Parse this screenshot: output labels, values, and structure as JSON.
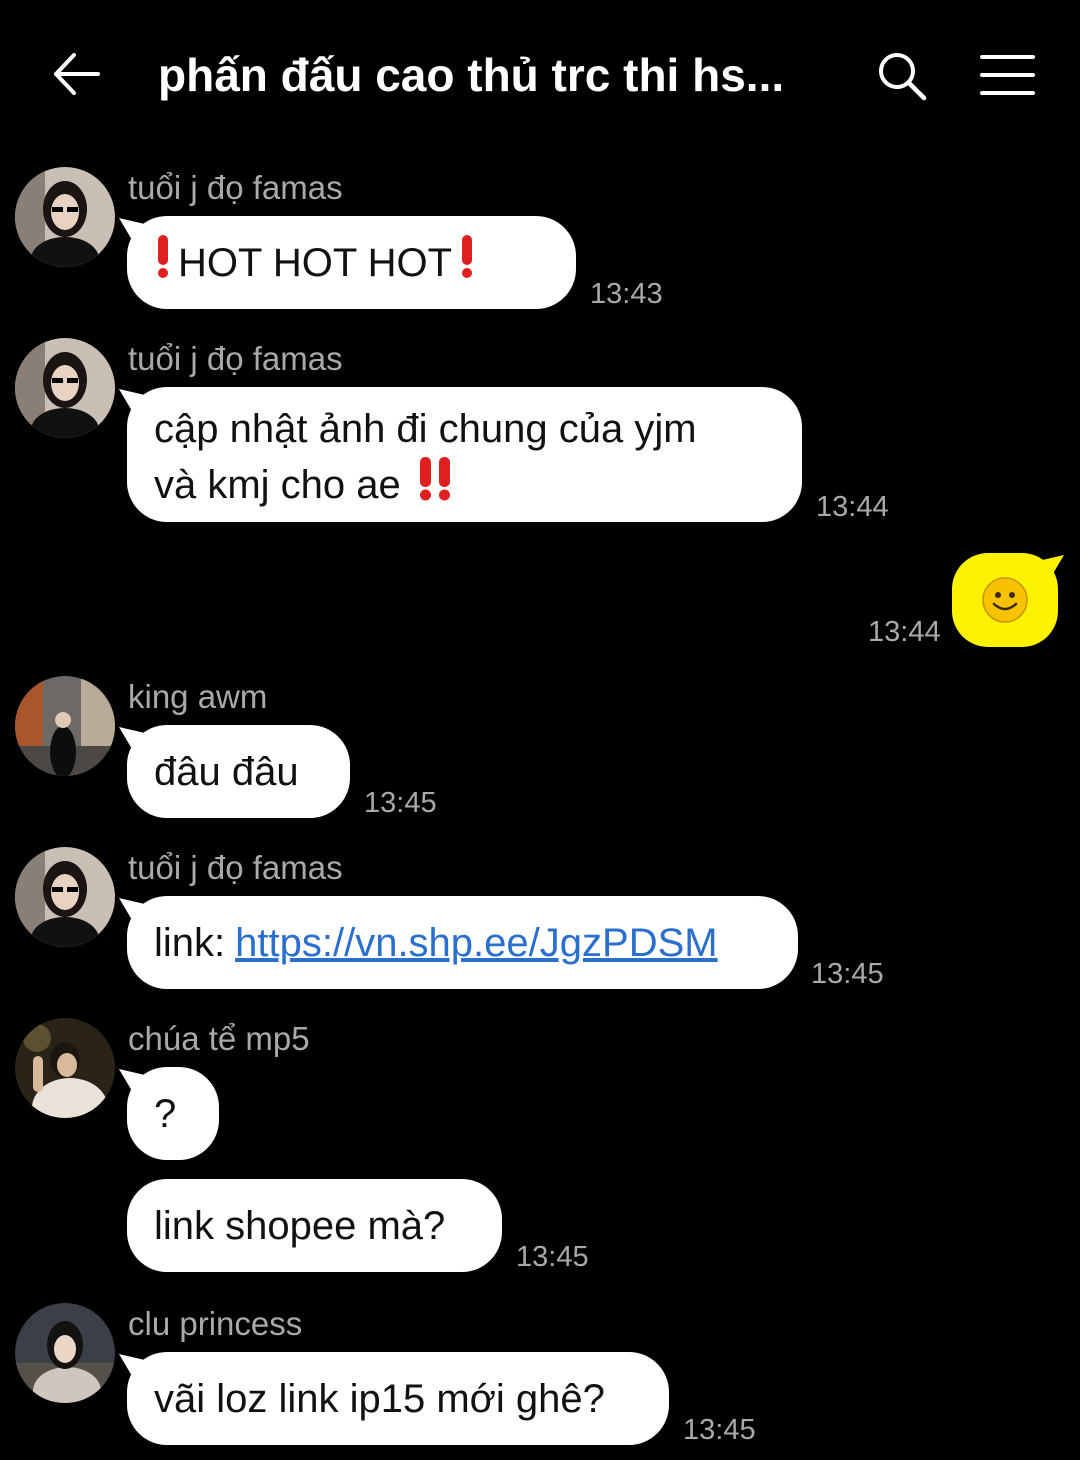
{
  "header": {
    "title": "phấn đấu cao thủ trc thi hs...",
    "back_icon": "back-arrow-icon",
    "search_icon": "search-icon",
    "menu_icon": "menu-icon"
  },
  "messages": [
    {
      "sender": "tuổi j đọ famas",
      "text": "HOT HOT HOT",
      "time": "13:43"
    },
    {
      "sender": "tuổi j đọ famas",
      "line1": "cập nhật ảnh đi chung của yjm",
      "line2": "và kmj cho ae",
      "time": "13:44"
    },
    {
      "own": true,
      "emoji": "🙂",
      "time": "13:44"
    },
    {
      "sender": "king awm",
      "text": "đâu đâu",
      "time": "13:45"
    },
    {
      "sender": "tuổi j đọ famas",
      "prefix": "link:",
      "link": "https://vn.shp.ee/JgzPDSM",
      "time": "13:45"
    },
    {
      "sender": "chúa tể mp5",
      "text": "?"
    },
    {
      "text": "link shopee mà?",
      "time": "13:45"
    },
    {
      "sender": "clu princess",
      "text": "vãi loz link ip15 mới ghê?",
      "time": "13:45"
    }
  ],
  "colors": {
    "background": "#000000",
    "incoming_bubble": "#ffffff",
    "outgoing_bubble": "#fff200",
    "meta_text": "#a9a9a9",
    "link": "#2a6fce",
    "alert_red": "#e02020"
  }
}
